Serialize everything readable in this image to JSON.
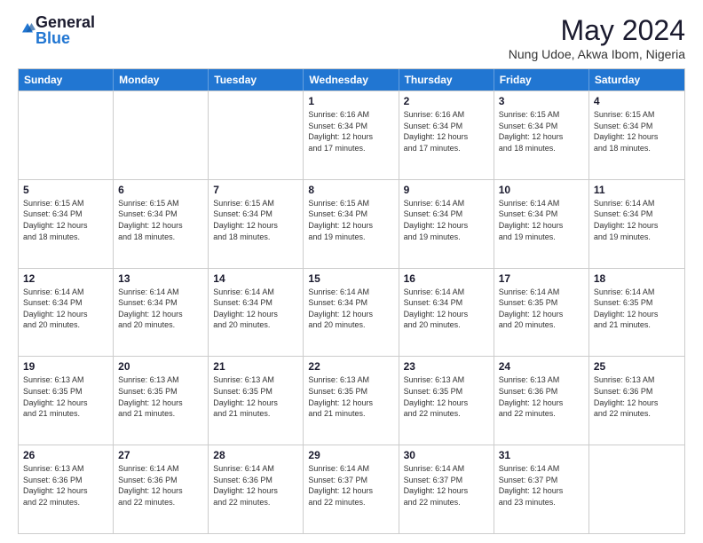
{
  "logo": {
    "general": "General",
    "blue": "Blue"
  },
  "title": "May 2024",
  "location": "Nung Udoe, Akwa Ibom, Nigeria",
  "weekdays": [
    "Sunday",
    "Monday",
    "Tuesday",
    "Wednesday",
    "Thursday",
    "Friday",
    "Saturday"
  ],
  "weeks": [
    [
      {
        "day": "",
        "info": ""
      },
      {
        "day": "",
        "info": ""
      },
      {
        "day": "",
        "info": ""
      },
      {
        "day": "1",
        "info": "Sunrise: 6:16 AM\nSunset: 6:34 PM\nDaylight: 12 hours\nand 17 minutes."
      },
      {
        "day": "2",
        "info": "Sunrise: 6:16 AM\nSunset: 6:34 PM\nDaylight: 12 hours\nand 17 minutes."
      },
      {
        "day": "3",
        "info": "Sunrise: 6:15 AM\nSunset: 6:34 PM\nDaylight: 12 hours\nand 18 minutes."
      },
      {
        "day": "4",
        "info": "Sunrise: 6:15 AM\nSunset: 6:34 PM\nDaylight: 12 hours\nand 18 minutes."
      }
    ],
    [
      {
        "day": "5",
        "info": "Sunrise: 6:15 AM\nSunset: 6:34 PM\nDaylight: 12 hours\nand 18 minutes."
      },
      {
        "day": "6",
        "info": "Sunrise: 6:15 AM\nSunset: 6:34 PM\nDaylight: 12 hours\nand 18 minutes."
      },
      {
        "day": "7",
        "info": "Sunrise: 6:15 AM\nSunset: 6:34 PM\nDaylight: 12 hours\nand 18 minutes."
      },
      {
        "day": "8",
        "info": "Sunrise: 6:15 AM\nSunset: 6:34 PM\nDaylight: 12 hours\nand 19 minutes."
      },
      {
        "day": "9",
        "info": "Sunrise: 6:14 AM\nSunset: 6:34 PM\nDaylight: 12 hours\nand 19 minutes."
      },
      {
        "day": "10",
        "info": "Sunrise: 6:14 AM\nSunset: 6:34 PM\nDaylight: 12 hours\nand 19 minutes."
      },
      {
        "day": "11",
        "info": "Sunrise: 6:14 AM\nSunset: 6:34 PM\nDaylight: 12 hours\nand 19 minutes."
      }
    ],
    [
      {
        "day": "12",
        "info": "Sunrise: 6:14 AM\nSunset: 6:34 PM\nDaylight: 12 hours\nand 20 minutes."
      },
      {
        "day": "13",
        "info": "Sunrise: 6:14 AM\nSunset: 6:34 PM\nDaylight: 12 hours\nand 20 minutes."
      },
      {
        "day": "14",
        "info": "Sunrise: 6:14 AM\nSunset: 6:34 PM\nDaylight: 12 hours\nand 20 minutes."
      },
      {
        "day": "15",
        "info": "Sunrise: 6:14 AM\nSunset: 6:34 PM\nDaylight: 12 hours\nand 20 minutes."
      },
      {
        "day": "16",
        "info": "Sunrise: 6:14 AM\nSunset: 6:34 PM\nDaylight: 12 hours\nand 20 minutes."
      },
      {
        "day": "17",
        "info": "Sunrise: 6:14 AM\nSunset: 6:35 PM\nDaylight: 12 hours\nand 20 minutes."
      },
      {
        "day": "18",
        "info": "Sunrise: 6:14 AM\nSunset: 6:35 PM\nDaylight: 12 hours\nand 21 minutes."
      }
    ],
    [
      {
        "day": "19",
        "info": "Sunrise: 6:13 AM\nSunset: 6:35 PM\nDaylight: 12 hours\nand 21 minutes."
      },
      {
        "day": "20",
        "info": "Sunrise: 6:13 AM\nSunset: 6:35 PM\nDaylight: 12 hours\nand 21 minutes."
      },
      {
        "day": "21",
        "info": "Sunrise: 6:13 AM\nSunset: 6:35 PM\nDaylight: 12 hours\nand 21 minutes."
      },
      {
        "day": "22",
        "info": "Sunrise: 6:13 AM\nSunset: 6:35 PM\nDaylight: 12 hours\nand 21 minutes."
      },
      {
        "day": "23",
        "info": "Sunrise: 6:13 AM\nSunset: 6:35 PM\nDaylight: 12 hours\nand 22 minutes."
      },
      {
        "day": "24",
        "info": "Sunrise: 6:13 AM\nSunset: 6:36 PM\nDaylight: 12 hours\nand 22 minutes."
      },
      {
        "day": "25",
        "info": "Sunrise: 6:13 AM\nSunset: 6:36 PM\nDaylight: 12 hours\nand 22 minutes."
      }
    ],
    [
      {
        "day": "26",
        "info": "Sunrise: 6:13 AM\nSunset: 6:36 PM\nDaylight: 12 hours\nand 22 minutes."
      },
      {
        "day": "27",
        "info": "Sunrise: 6:14 AM\nSunset: 6:36 PM\nDaylight: 12 hours\nand 22 minutes."
      },
      {
        "day": "28",
        "info": "Sunrise: 6:14 AM\nSunset: 6:36 PM\nDaylight: 12 hours\nand 22 minutes."
      },
      {
        "day": "29",
        "info": "Sunrise: 6:14 AM\nSunset: 6:37 PM\nDaylight: 12 hours\nand 22 minutes."
      },
      {
        "day": "30",
        "info": "Sunrise: 6:14 AM\nSunset: 6:37 PM\nDaylight: 12 hours\nand 22 minutes."
      },
      {
        "day": "31",
        "info": "Sunrise: 6:14 AM\nSunset: 6:37 PM\nDaylight: 12 hours\nand 23 minutes."
      },
      {
        "day": "",
        "info": ""
      }
    ]
  ]
}
